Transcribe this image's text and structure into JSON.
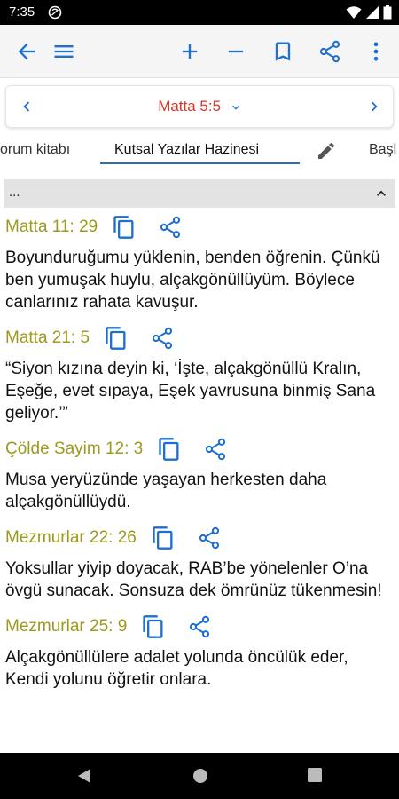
{
  "status_bar": {
    "time": "7:35"
  },
  "toolbar": {
    "icons": [
      "back-arrow-icon",
      "menu-icon",
      "plus-icon",
      "minus-icon",
      "bookmark-icon",
      "share-icon",
      "more-vert-icon"
    ]
  },
  "selector": {
    "reference": "Matta 5:5"
  },
  "tabs": [
    {
      "label": "orum kitabı"
    },
    {
      "label": "Kutsal Yazılar Hazinesi"
    },
    {
      "label": "Başl"
    }
  ],
  "section": {
    "label": "..."
  },
  "entries": [
    {
      "ref": "Matta 11: 29",
      "text": "Boyunduruğumu yüklenin, benden öğrenin. Çünkü ben yumuşak huylu, alçakgönüllüyüm. Böylece canlarınız rahata kavuşur."
    },
    {
      "ref": "Matta 21: 5",
      "text": "“Siyon kızına deyin ki, ‘İşte, alçakgönüllü Kralın, Eşeğe, evet sıpaya, Eşek yavrusuna binmiş Sana geliyor.’”"
    },
    {
      "ref": "Çölde Sayim 12: 3",
      "text": "Musa yeryüzünde yaşayan herkesten daha alçakgönüllüydü."
    },
    {
      "ref": "Mezmurlar 22: 26",
      "text": "Yoksullar yiyip doyacak, RAB’be yönelenler O’na övgü sunacak. Sonsuza dek ömrünüz tükenmesin!"
    },
    {
      "ref": "Mezmurlar 25: 9",
      "text": "Alçakgönüllülere adalet yolunda öncülük eder, Kendi yolunu öğretir onlara."
    }
  ],
  "colors": {
    "accent": "#1e6fd0",
    "reference_red": "#d0392b",
    "ref_olive": "#9c9a1c"
  }
}
